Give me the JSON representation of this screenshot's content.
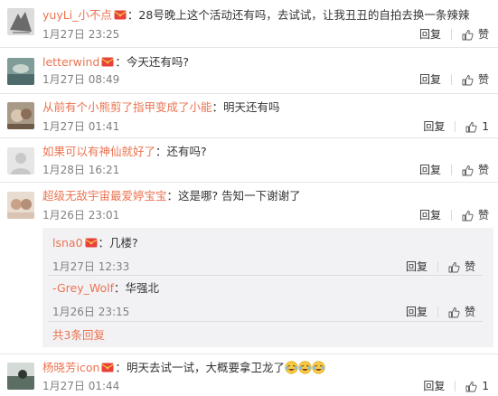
{
  "reply_label": "回复",
  "like_label": "赞",
  "separator": "：",
  "comments": [
    {
      "user": "yuyLi_小不点",
      "text": "28号晚上这个活动还有吗，去试试，让我丑丑的自拍去换一条辣辣",
      "time": "1月27日 23:25",
      "likes": "赞"
    },
    {
      "user": "letterwind",
      "text": "今天还有吗?",
      "time": "1月27日 08:49",
      "likes": "赞"
    },
    {
      "user": "从前有个小熊剪了指甲变成了小能",
      "text": "明天还有吗",
      "time": "1月27日 01:41",
      "likes": "1"
    },
    {
      "user": "如果可以有神仙就好了",
      "text": "还有吗?",
      "time": "1月28日 16:21",
      "likes": "赞"
    },
    {
      "user": "超级无敌宇宙最爱婷宝宝",
      "text": "这是哪? 告知一下谢谢了",
      "time": "1月26日 23:01",
      "likes": "赞"
    },
    {
      "user": "杨晓芳icon",
      "text": "明天去试一试，大概要拿卫龙了",
      "time": "1月27日 01:44",
      "likes": "1"
    }
  ],
  "sub_replies": [
    {
      "user": "lsna0",
      "text": "几楼?",
      "time": "1月27日 12:33",
      "likes": "赞"
    },
    {
      "user": "-Grey_Wolf",
      "text": "华强北",
      "time": "1月26日 23:15",
      "likes": "赞"
    }
  ],
  "more_replies": "共3条回复",
  "icons": {
    "vip": "red-envelope-vip-icon",
    "like": "thumbs-up-icon",
    "emoji": "laughing-tears-emoji"
  },
  "colors": {
    "username": "#eb7350",
    "muted": "#808080",
    "sub_bg": "#f2f2f5"
  }
}
